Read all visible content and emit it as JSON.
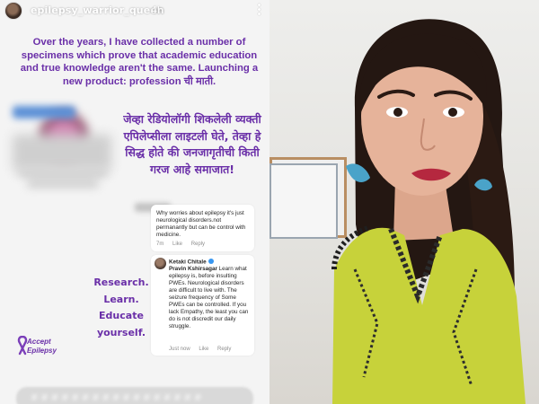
{
  "story": {
    "username": "epilepsy_warrior_queen",
    "timestamp": "4h",
    "caption_en": "Over the years, I have collected a number of specimens which prove that academic education and true knowledge aren't the same. Launching a new product: profession ची माती.",
    "caption_mr": "जेव्हा रेडियोलॉगी शिकलेली व्यक्ती एपिलेप्सीला लाइटली घेते, तेव्हा हे सिद्ध होते की जनजागृतीची किती गरज आहे समाजात!",
    "comment_1": {
      "text": "Why worries about epilepsy it's just neurological disorders.not permanantly but can be control with medicine.",
      "age": "7m",
      "like": "Like",
      "reply": "Reply"
    },
    "comment_2": {
      "author": "Ketaki Chitale",
      "mention": "Pravin Kshirsagar",
      "text": "Learn what epilepsy is, before insulting PWEs. Neurological disorders are difficult to live with. The seizure frequency of Some PWEs can be controlled. If you lack Empathy, the least you can do is not discredit our daily struggle.",
      "age": "Just now",
      "like": "Like",
      "reply": "Reply"
    },
    "research": [
      "Research.",
      "Learn.",
      "Educate",
      "yourself."
    ],
    "logo": [
      "Accept",
      "Epilepsy"
    ]
  },
  "colors": {
    "accent": "#6a2fa8",
    "story_bg": "#f4f4f4"
  }
}
